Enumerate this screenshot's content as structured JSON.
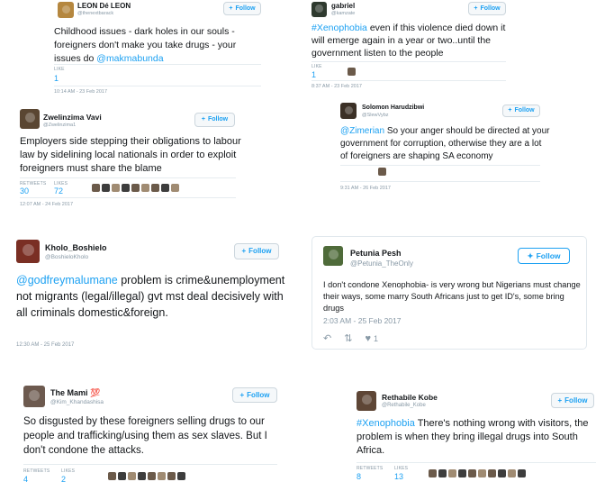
{
  "tweets": [
    {
      "name": "LEON Dé LEON",
      "handle": "@thenextbarack",
      "follow": "Follow",
      "text": "Childhood issues - dark holes in our souls - foreigners don't make you take drugs - your issues do ",
      "mention": "@makmabunda",
      "likes_label": "LIKE",
      "likes": "1",
      "time": "10:14 AM - 23 Feb 2017"
    },
    {
      "name": "gabriel",
      "handle": "@kamzate",
      "follow": "Follow",
      "hashtag": "#Xenophobia",
      "text": " even if this violence died down it will emerge again in a year or two..until the government listen to the people",
      "likes_label": "LIKE",
      "likes": "1",
      "time": "8:37 AM - 23 Feb 2017"
    },
    {
      "name": "Zwelinzima Vavi",
      "handle": "@Zwelinzima1",
      "follow": "Follow",
      "text": "Employers side stepping their obligations to labour law by sidelining local nationals in order to exploit foreigners must share the blame",
      "retweets_label": "RETWEETS",
      "retweets": "30",
      "likes_label": "LIKES",
      "likes": "72",
      "time": "12:07 AM - 24 Feb 2017"
    },
    {
      "name": "Solomon Harudzibwi",
      "handle": "@SlewVybz",
      "follow": "Follow",
      "mention": "@Zimerian",
      "text": " So your anger should be directed at your government for corruption, otherwise they are a lot of foreigners are shaping SA economy",
      "time": "9:31 AM - 26 Feb 2017"
    },
    {
      "name": "Kholo_Boshielo",
      "handle": "@BoshieloKholo",
      "follow": "Follow",
      "mention": "@godfreymalumane",
      "text": " problem is crime&unemployment not migrants (legal/illegal) gvt mst deal decisively with all criminals domestic&foreign.",
      "time": "12:30 AM - 25 Feb 2017"
    },
    {
      "name": "Petunia Pesh",
      "handle": "@Petunia_TheOnly",
      "follow": "Follow",
      "text": "I don't condone Xenophobia- is very wrong but Nigerians must change their ways, some marry South Africans just to get ID's, some bring drugs",
      "time": "2:03 AM - 25 Feb 2017",
      "like_count": "1"
    },
    {
      "name": "The Mami 💯",
      "handle": "@Kim_Khandashisa",
      "follow": "Follow",
      "text": "So disgusted by these foreigners selling drugs to our people and trafficking/using them as sex slaves. But I don't condone the attacks.",
      "retweets_label": "RETWEETS",
      "retweets": "4",
      "likes_label": "LIKES",
      "likes": "2"
    },
    {
      "name": "Rethabile Kobe",
      "handle": "@Rethabile_Kobe",
      "follow": "Follow",
      "hashtag": "#Xenophobia",
      "text": " There's nothing wrong with visitors, the problem is when they bring illegal drugs into South Africa.",
      "retweets_label": "RETWEETS",
      "retweets": "8",
      "likes_label": "LIKES",
      "likes": "13"
    }
  ],
  "icons": {
    "follow_plus": "person-plus-icon",
    "twitter_bird": "twitter-bird-icon",
    "reply": "reply-icon",
    "retweet": "retweet-icon",
    "like": "heart-icon"
  },
  "colors": {
    "link": "#1da1f2",
    "muted": "#8899a6",
    "text": "#14171a"
  }
}
